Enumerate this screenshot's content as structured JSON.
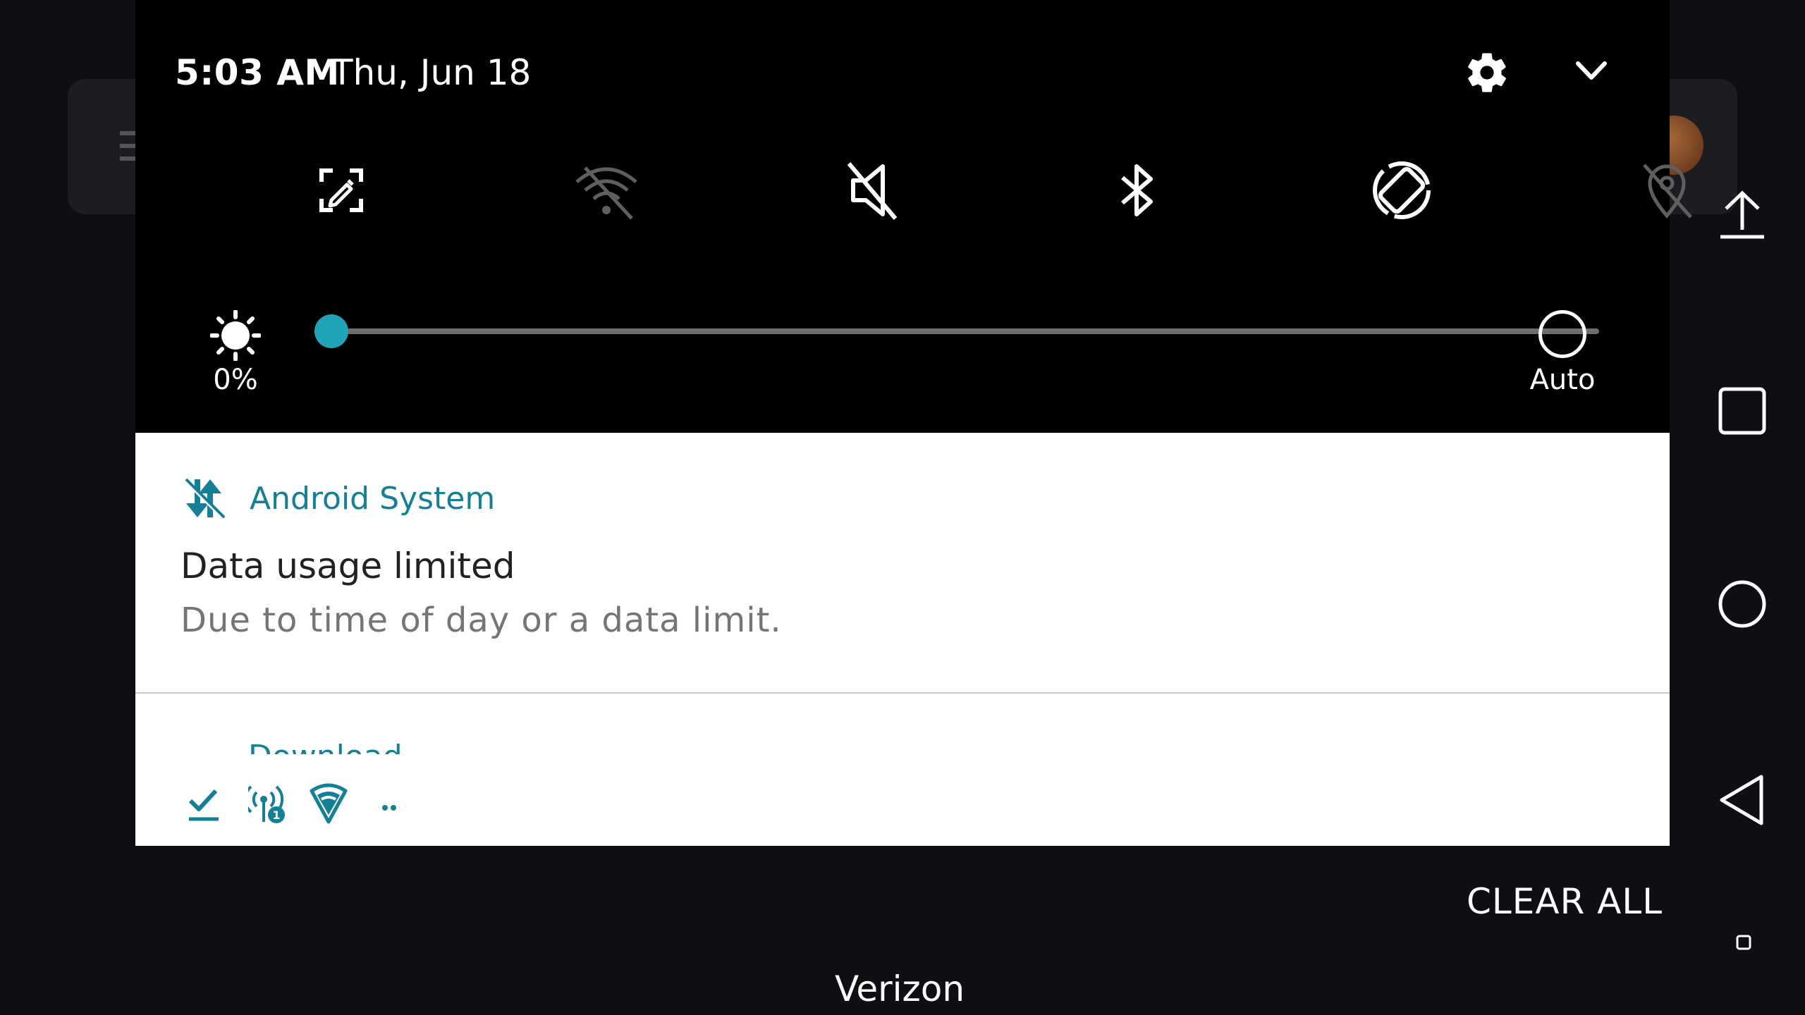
{
  "status": {
    "time": "5:03 AM",
    "date": "Thu, Jun 18",
    "carrier": "Verizon"
  },
  "quick_settings": {
    "tiles": [
      {
        "name": "edit",
        "icon": "edit-tiles-icon",
        "active": true
      },
      {
        "name": "wifi",
        "icon": "wifi-off-icon",
        "active": false
      },
      {
        "name": "sound",
        "icon": "sound-muted-icon",
        "active": true
      },
      {
        "name": "bluetooth",
        "icon": "bluetooth-icon",
        "active": true
      },
      {
        "name": "auto-rotate",
        "icon": "auto-rotate-icon",
        "active": true
      },
      {
        "name": "location",
        "icon": "location-off-icon",
        "active": false
      }
    ],
    "brightness": {
      "percent_label": "0%",
      "level": 0,
      "auto_label": "Auto"
    }
  },
  "notifications": [
    {
      "app": "Android System",
      "title": "Data usage limited",
      "text": "Due to time of day or a data limit.",
      "icon": "data-saver-icon"
    },
    {
      "app_partial": "Download M",
      "icons": [
        "check-download-icon",
        "hotspot-icon",
        "vpn-shield-icon",
        "more-dots-icon"
      ]
    }
  ],
  "actions": {
    "clear_all": "CLEAR ALL"
  },
  "nav": [
    "upload-icon",
    "recents-icon",
    "home-icon",
    "back-icon",
    "small-square-icon"
  ],
  "colors": {
    "accent": "#20a4b8",
    "app_name": "#157f98",
    "panel_bg": "#000000",
    "page_bg": "#0d0f13"
  }
}
